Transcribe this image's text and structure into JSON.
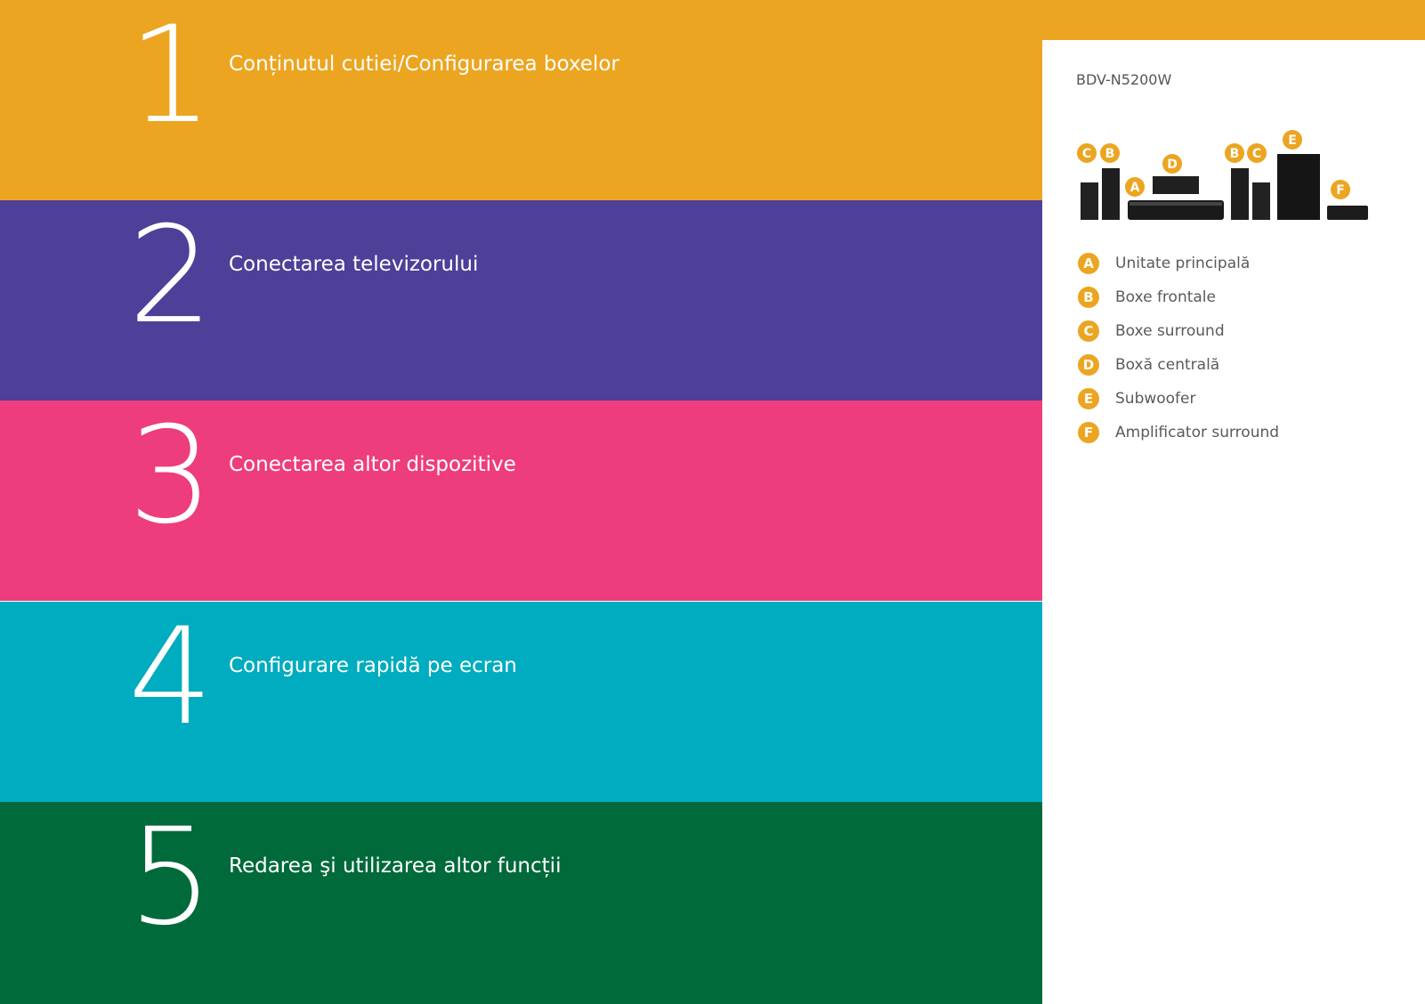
{
  "colors": {
    "section_1": "#ECA521",
    "section_2": "#4E3F98",
    "section_3": "#EE3D7C",
    "section_4": "#00ACBF",
    "section_5": "#006A3A",
    "badge": "#ECA521"
  },
  "sections": [
    {
      "number": "1",
      "title": "Conținutul cutiei/Configurarea boxelor"
    },
    {
      "number": "2",
      "title": "Conectarea televizorului"
    },
    {
      "number": "3",
      "title": "Conectarea altor dispozitive"
    },
    {
      "number": "4",
      "title": "Configurare rapidă pe ecran"
    },
    {
      "number": "5",
      "title": "Redarea şi utilizarea altor funcții"
    }
  ],
  "panel": {
    "model": "BDV-N5200W",
    "illustration_badges": [
      "C",
      "B",
      "A",
      "D",
      "B",
      "C",
      "E",
      "F"
    ],
    "legend": [
      {
        "letter": "A",
        "label": "Unitate principală"
      },
      {
        "letter": "B",
        "label": "Boxe frontale"
      },
      {
        "letter": "C",
        "label": "Boxe surround"
      },
      {
        "letter": "D",
        "label": "Boxă centrală"
      },
      {
        "letter": "E",
        "label": "Subwoofer"
      },
      {
        "letter": "F",
        "label": "Amplificator surround"
      }
    ]
  }
}
